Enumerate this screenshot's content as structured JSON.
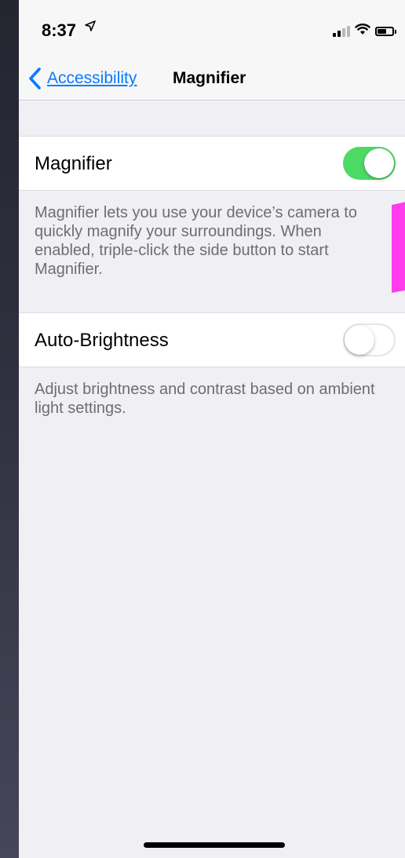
{
  "status_bar": {
    "time": "8:37",
    "location_icon": "location-arrow-icon",
    "icons": [
      "cellular-signal-icon",
      "wifi-icon",
      "battery-icon"
    ]
  },
  "nav": {
    "back_label": "Accessibility",
    "title": "Magnifier",
    "accent_color": "#0a7aff"
  },
  "settings": {
    "magnifier": {
      "label": "Magnifier",
      "enabled": true,
      "description": "Magnifier lets you use your device’s camera to quickly magnify your surroundings. When enabled, triple-click the side button to start Magnifier."
    },
    "auto_brightness": {
      "label": "Auto-Brightness",
      "enabled": false,
      "description": "Adjust brightness and contrast based on ambient light settings."
    }
  },
  "colors": {
    "toggle_on": "#4cd964",
    "annotation_marker": "#ff3dee",
    "grouped_background": "#efeff4"
  }
}
